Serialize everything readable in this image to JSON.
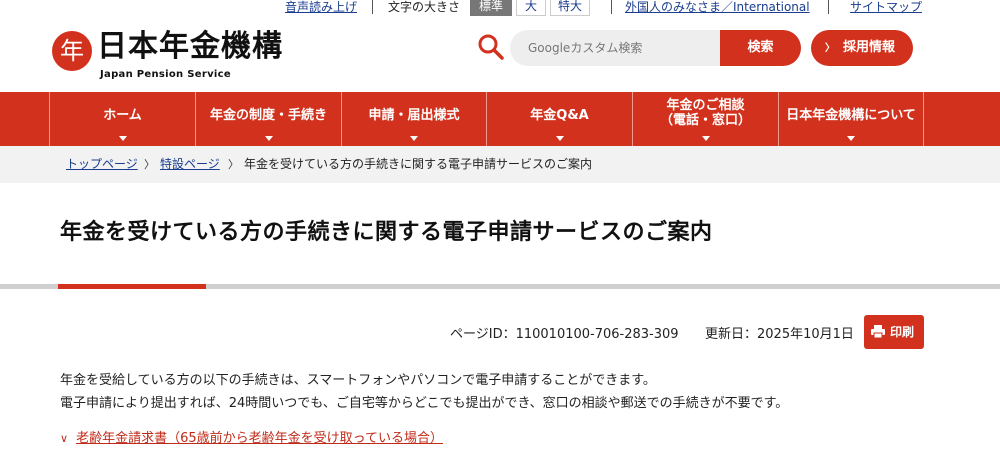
{
  "utility": {
    "read_aloud": "音声読み上げ",
    "text_size_label": "文字の大きさ",
    "size_standard": "標準",
    "size_large": "大",
    "size_xlarge": "特大",
    "international": "外国人のみなさま／International",
    "sitemap": "サイトマップ"
  },
  "header": {
    "logo_mark": "年",
    "logo_text": "日本年金機構",
    "logo_sub": "Japan Pension Service",
    "search_placeholder": "Googleカスタム検索",
    "search_button": "検索",
    "recruit_button": "採用情報"
  },
  "nav": {
    "items": [
      {
        "label": "ホーム"
      },
      {
        "label": "年金の制度・手続き"
      },
      {
        "label": "申請・届出様式"
      },
      {
        "label": "年金Q&A"
      },
      {
        "label": "年金のご相談\n（電話・窓口）"
      },
      {
        "label": "日本年金機構について"
      }
    ]
  },
  "breadcrumb": {
    "items": [
      "トップページ",
      "特設ページ"
    ],
    "current": "年金を受けている方の手続きに関する電子申請サービスのご案内"
  },
  "page": {
    "title": "年金を受けている方の手続きに関する電子申請サービスのご案内",
    "page_id": "ページID：110010100-706-283-309",
    "updated": "更新日：2025年10月1日",
    "print_label": "印刷",
    "intro_line1": "年金を受給している方の以下の手続きは、スマートフォンやパソコンで電子申請することができます。",
    "intro_line2": "電子申請により提出すれば、24時間いつでも、ご自宅等からどこでも提出ができ、窓口の相談や郵送での手続きが不要です。",
    "link1": "老齢年金請求書（65歳前から老齢年金を受け取っている場合）"
  },
  "colors": {
    "brand_red": "#d2321d",
    "link_blue": "#1a3d8f"
  }
}
